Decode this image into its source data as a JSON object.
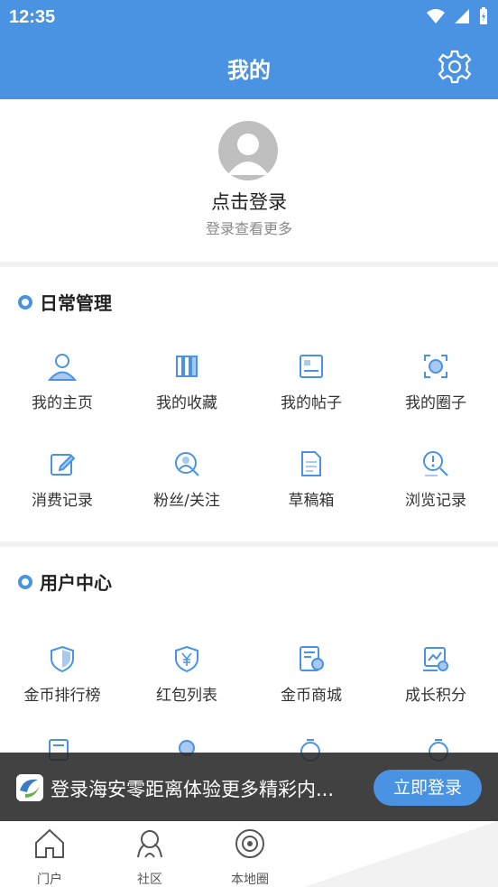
{
  "status": {
    "time": "12:35"
  },
  "header": {
    "title": "我的"
  },
  "profile": {
    "login_label": "点击登录",
    "sub_label": "登录查看更多"
  },
  "daily": {
    "title": "日常管理",
    "items": [
      {
        "label": "我的主页",
        "icon": "user-icon"
      },
      {
        "label": "我的收藏",
        "icon": "books-icon"
      },
      {
        "label": "我的帖子",
        "icon": "post-card-icon"
      },
      {
        "label": "我的圈子",
        "icon": "circle-face-icon"
      },
      {
        "label": "消费记录",
        "icon": "edit-icon"
      },
      {
        "label": "粉丝/关注",
        "icon": "follow-search-icon"
      },
      {
        "label": "草稿箱",
        "icon": "document-icon"
      },
      {
        "label": "浏览记录",
        "icon": "history-search-icon"
      }
    ]
  },
  "user_center": {
    "title": "用户中心",
    "items": [
      {
        "label": "金币排行榜",
        "icon": "shield-icon"
      },
      {
        "label": "红包列表",
        "icon": "yen-shield-icon"
      },
      {
        "label": "金币商城",
        "icon": "mall-icon"
      },
      {
        "label": "成长积分",
        "icon": "score-chart-icon"
      }
    ]
  },
  "banner": {
    "text": "登录海安零距离体验更多精彩内...",
    "button": "立即登录"
  },
  "bottom_nav": [
    {
      "label": "门户",
      "icon": "home-icon"
    },
    {
      "label": "社区",
      "icon": "community-icon"
    },
    {
      "label": "本地圈",
      "icon": "local-circle-icon"
    }
  ],
  "colors": {
    "primary": "#4a93e3",
    "text": "#333333",
    "muted": "#8a8a8a"
  }
}
